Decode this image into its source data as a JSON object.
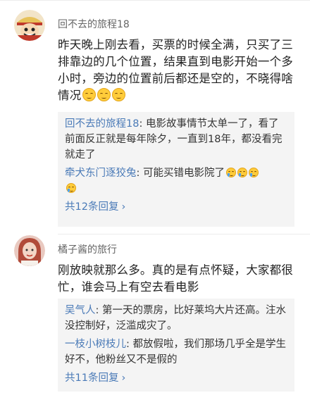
{
  "comments": [
    {
      "username": "回不去的旅程18",
      "text": "昨天晚上刚去看，买票的时候全满，只买了三排靠边的几个位置，结果直到电影开始一个多小时，旁边的位置前后都还是空的，不晓得啥情况",
      "emojis": [
        "smirk-emoji",
        "smirk-emoji",
        "smirk-emoji"
      ],
      "replies": [
        {
          "name": "回不去的旅程18",
          "sep": ": ",
          "text": "电影故事情节太单一了，看了前面反正就是每年除夕，一直到18年，都没看完就走了"
        },
        {
          "name": "牵犬东门逐狡兔",
          "sep": ": ",
          "text": "可能买错电影院了"
        }
      ],
      "more": "共12条回复"
    },
    {
      "username": "橘子酱的旅行",
      "text": "刚放映就那么多。真的是有点怀疑，大家都很忙，谁会马上有空去看电影",
      "replies": [
        {
          "name": "吴气人",
          "sep": ": ",
          "text": "第一天的票房，比好莱坞大片还高。注水没控制好，泛滥成灾了。"
        },
        {
          "name": "一枝小树枝儿",
          "sep": ": ",
          "text": "都放假啦，我们那场几乎全是学生好不，他粉丝又不是假的"
        }
      ],
      "more": "共11条回复"
    }
  ],
  "icons": {
    "chevron": "›",
    "more_chevron_name": "chevron-right-icon"
  }
}
